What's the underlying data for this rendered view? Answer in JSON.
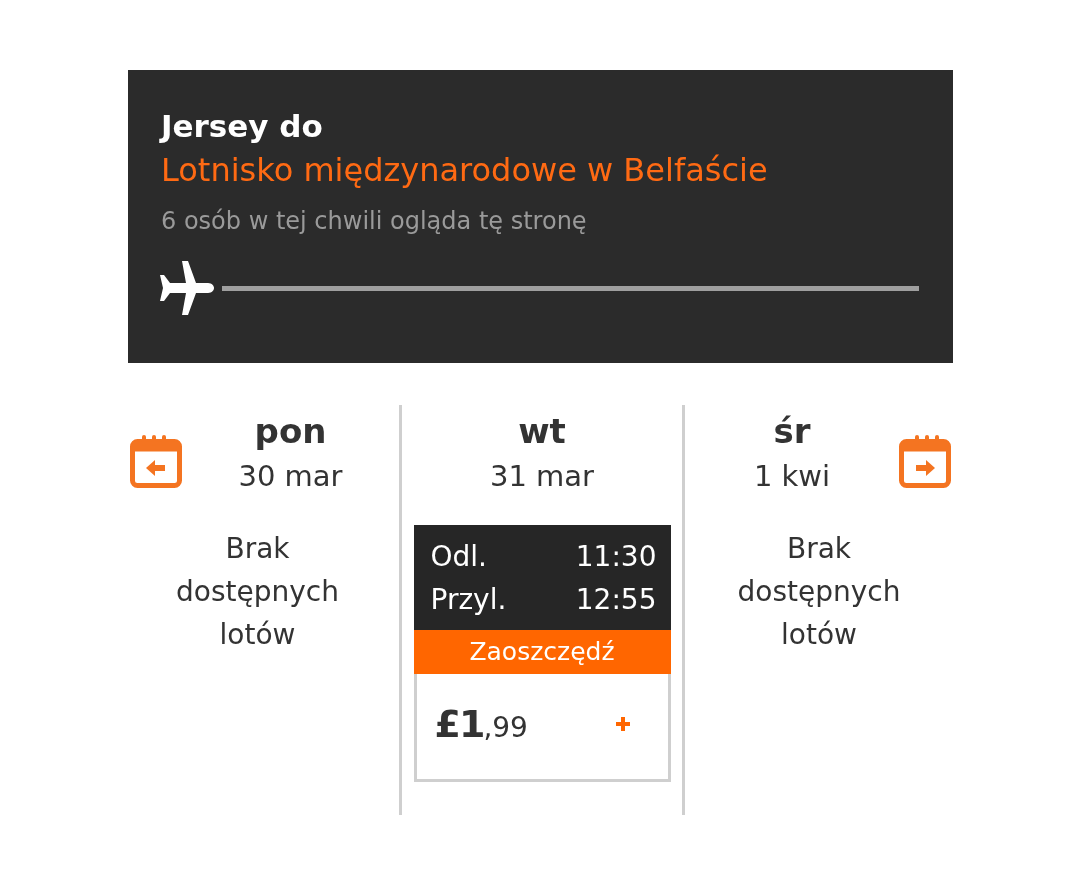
{
  "route": {
    "origin": "Jersey do",
    "destination": "Lotnisko międzynarodowe w Belfaście",
    "viewers": "6 osób w tej chwili ogląda tę stronę"
  },
  "days": [
    {
      "kind": "empty",
      "weekday": "pon",
      "date": "30 mar",
      "message": "Brak dostępnych lotów"
    },
    {
      "kind": "flights",
      "weekday": "wt",
      "date": "31 mar",
      "flights": [
        {
          "departure_label": "Odl.",
          "departure": "11:30",
          "arrival_label": "Przyl.",
          "arrival": "12:55",
          "tag": "Zaoszczędź",
          "price": "**£1**,99"
        }
      ]
    },
    {
      "kind": "empty",
      "weekday": "śr",
      "date": "1 kwi",
      "message": "Brak dostępnych lotów"
    }
  ]
}
